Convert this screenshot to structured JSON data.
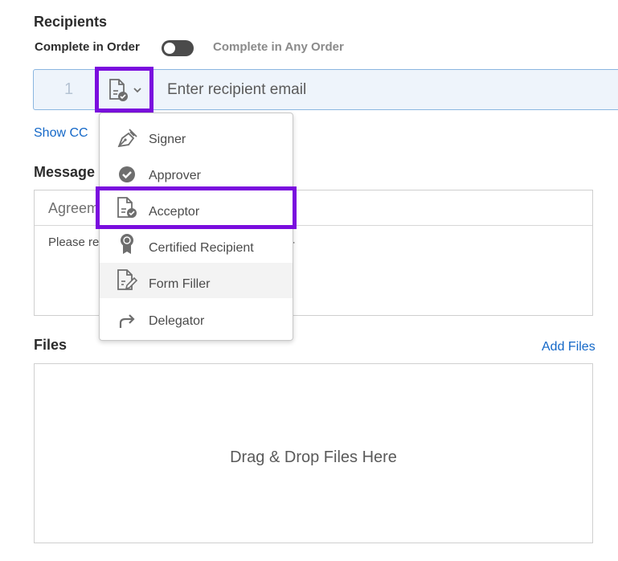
{
  "recipients": {
    "title": "Recipients",
    "order_on": "Complete in Order",
    "order_off": "Complete in Any Order",
    "row_number": "1",
    "email_placeholder": "Enter recipient email",
    "show_cc": "Show CC"
  },
  "message": {
    "title": "Message",
    "subject_partial": "Agreem",
    "body_partial": "Please re",
    "body_tail": "-"
  },
  "files": {
    "title": "Files",
    "add_files": "Add Files",
    "dropzone": "Drag & Drop Files Here"
  },
  "role_menu": {
    "items": [
      {
        "label": "Signer",
        "icon": "pen-nib-icon"
      },
      {
        "label": "Approver",
        "icon": "check-circle-icon"
      },
      {
        "label": "Acceptor",
        "icon": "document-check-icon"
      },
      {
        "label": "Certified Recipient",
        "icon": "ribbon-badge-icon"
      },
      {
        "label": "Form Filler",
        "icon": "document-edit-icon"
      },
      {
        "label": "Delegator",
        "icon": "forward-arrow-icon"
      }
    ]
  },
  "colors": {
    "highlight": "#7a0dde",
    "link": "#1468c8",
    "recipient_row_bg": "#eef4fb"
  }
}
